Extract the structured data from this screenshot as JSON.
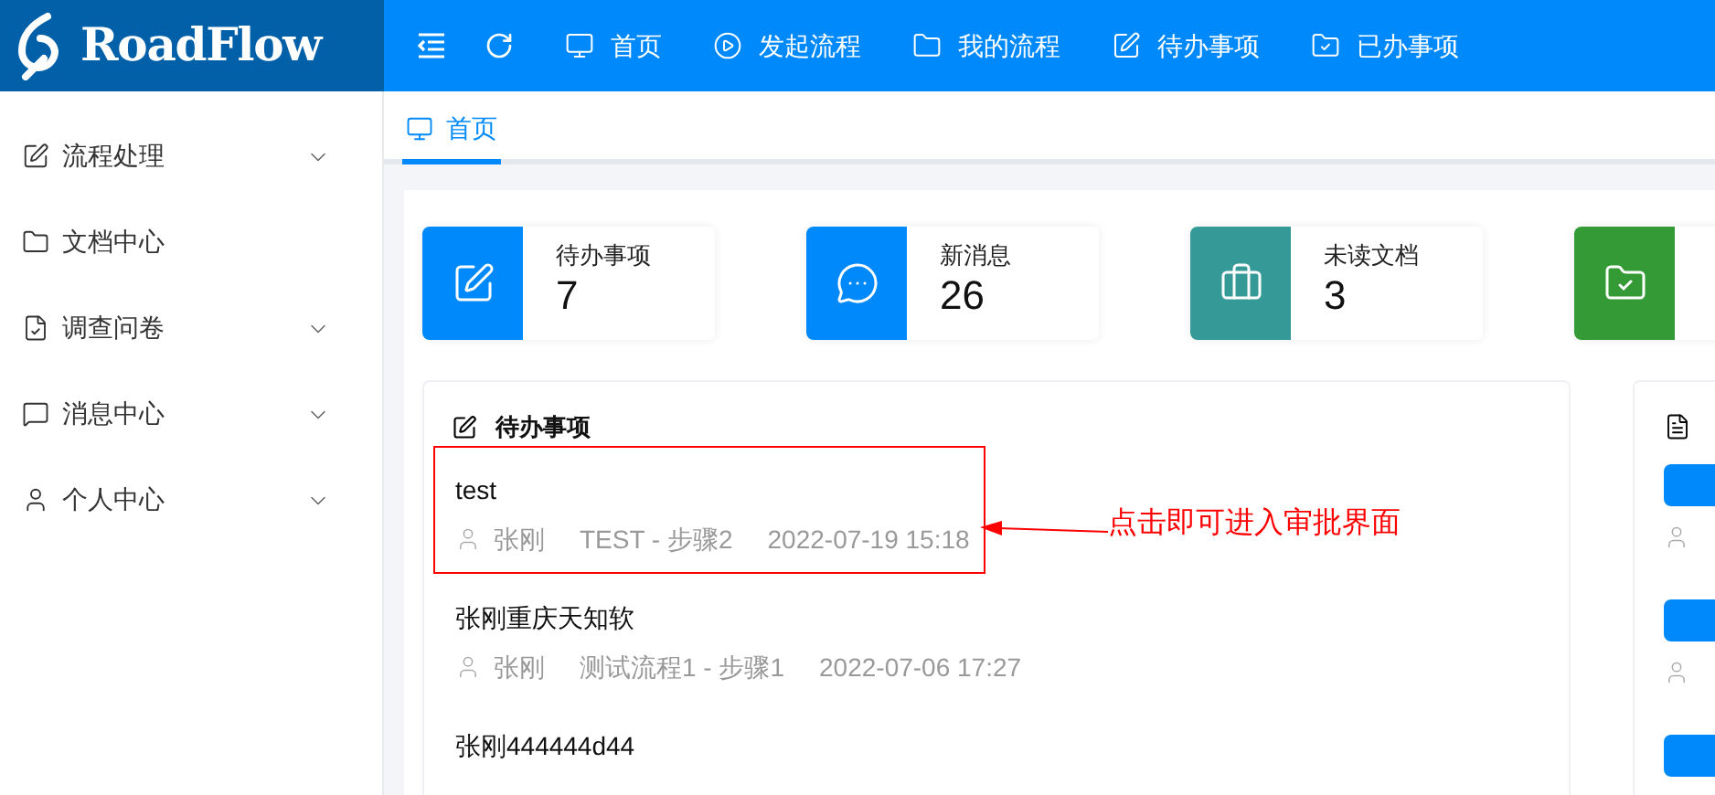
{
  "logo": {
    "text": "RoadFlow"
  },
  "top_nav": [
    {
      "label": "首页"
    },
    {
      "label": "发起流程"
    },
    {
      "label": "我的流程"
    },
    {
      "label": "待办事项"
    },
    {
      "label": "已办事项"
    }
  ],
  "sidebar": {
    "items": [
      {
        "label": "流程处理",
        "kind": "group"
      },
      {
        "label": "文档中心",
        "kind": "link"
      },
      {
        "label": "调查问卷",
        "kind": "group"
      },
      {
        "label": "消息中心",
        "kind": "group"
      },
      {
        "label": "个人中心",
        "kind": "group"
      }
    ]
  },
  "tabs": [
    {
      "label": "首页",
      "selected": true
    }
  ],
  "stats": [
    {
      "label": "待办事项",
      "value": "7",
      "color": "#0089fa"
    },
    {
      "label": "新消息",
      "value": "26",
      "color": "#0089fa"
    },
    {
      "label": "未读文档",
      "value": "3",
      "color": "#359a97"
    },
    {
      "color": "#339a35"
    }
  ],
  "todo_panel": {
    "title": "待办事项",
    "items": [
      {
        "title": "test",
        "user": "张刚",
        "step": "TEST - 步骤2",
        "time": "2022-07-19 15:18",
        "highlighted": true
      },
      {
        "title": "张刚重庆天知软",
        "user": "张刚",
        "step": "测试流程1 - 步骤1",
        "time": "2022-07-06 17:27",
        "highlighted": false
      },
      {
        "title": "张刚444444d44",
        "highlighted": false
      }
    ]
  },
  "annotation": {
    "text": "点击即可进入审批界面"
  }
}
